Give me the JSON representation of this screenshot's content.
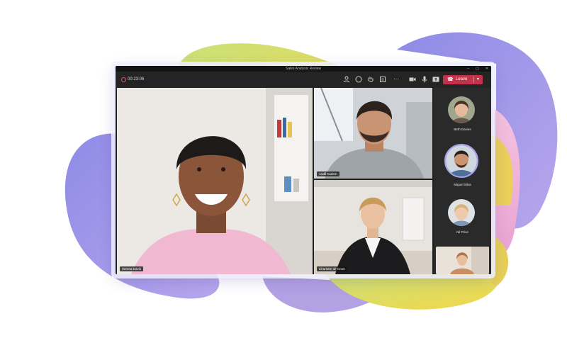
{
  "window": {
    "title": "Sales Analysis Review"
  },
  "toolbar": {
    "timer": "00:23:06",
    "leave_label": "Leave",
    "icons": [
      "people-icon",
      "chat-icon",
      "raise-hand-icon",
      "rooms-icon",
      "more-icon",
      "camera-icon",
      "mic-icon",
      "share-icon"
    ]
  },
  "participants": {
    "main": {
      "name": "Serena Davis"
    },
    "top_right": {
      "name": "Aadil Kadem"
    },
    "bottom_right": {
      "name": "Charlotte de Crum"
    }
  },
  "rail": {
    "items": [
      {
        "name": "Beth Davies"
      },
      {
        "name": "Miguel Silva"
      },
      {
        "name": "Nil Price"
      }
    ]
  },
  "colors": {
    "leave": "#c4314b",
    "blob_purple": "#9a95e8",
    "blob_yellow": "#e9df56",
    "blob_pink": "#f0b7d8",
    "speaking_ring": "#a7a3f5"
  }
}
